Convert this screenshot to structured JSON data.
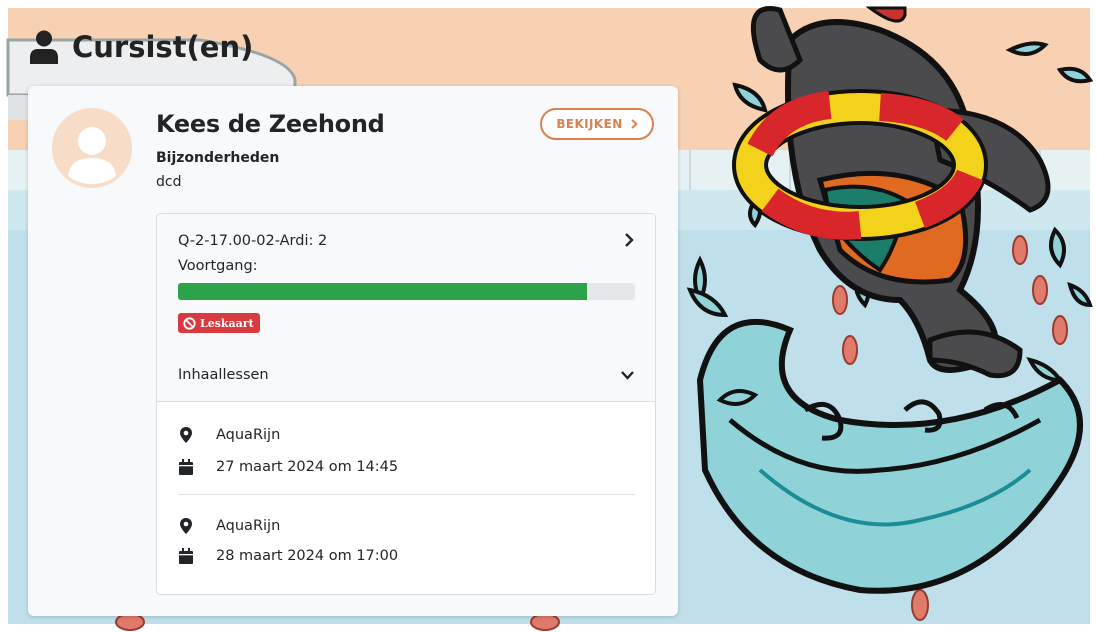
{
  "page": {
    "title": "Cursist(en)",
    "title_icon": "user-icon"
  },
  "student": {
    "name": "Kees de Zeehond",
    "details_label": "Bijzonderheden",
    "details_value": "dcd",
    "view_button_label": "BEKIJKEN",
    "avatar_icon": "user-avatar-icon"
  },
  "course": {
    "name": "Q-2-17.00-02-Ardi: 2",
    "progress_label": "Voortgang:",
    "progress_fraction": 0.895,
    "progress_color": "#2ca24a",
    "badge_label": "Leskaart",
    "badge_icon": "ban-icon",
    "badge_color": "#d83a3f"
  },
  "makeup": {
    "label": "Inhaallessen",
    "sessions": [
      {
        "location": "AquaRijn",
        "datetime": "27 maart 2024 om 14:45"
      },
      {
        "location": "AquaRijn",
        "datetime": "28 maart 2024 om 17:00"
      }
    ]
  },
  "colors": {
    "accent": "#d9814f",
    "danger": "#d83a3f",
    "success": "#2ca24a"
  }
}
